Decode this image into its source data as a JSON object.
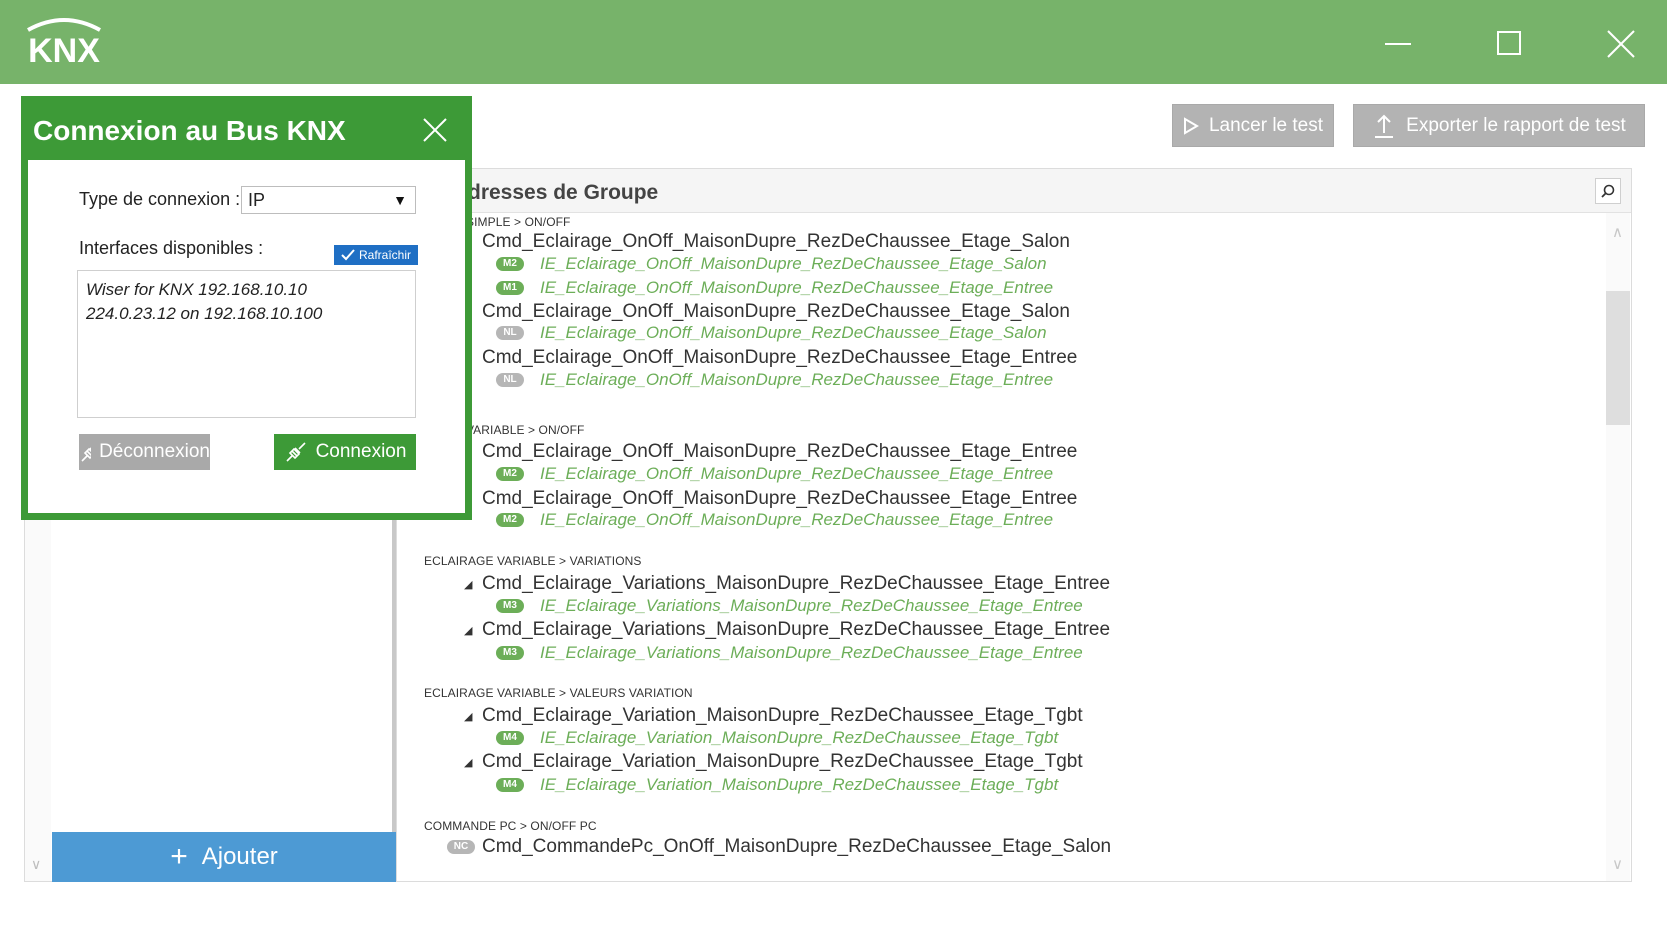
{
  "app": {
    "logo_text": "KNX"
  },
  "toolbar": {
    "run_test_label": "Lancer le test",
    "export_label": "Exporter le rapport de test"
  },
  "left_panel": {
    "add_label": "Ajouter"
  },
  "main": {
    "title": "dresses de Groupe",
    "groups": [
      {
        "category": "GE SIMPLE > ON/OFF",
        "items": [
          {
            "name": "Cmd_Eclairage_OnOff_MaisonDupre_RezDeChaussee_Etage_Salon",
            "objects": [
              {
                "badge": "M2",
                "name": "IE_Eclairage_OnOff_MaisonDupre_RezDeChaussee_Etage_Salon"
              },
              {
                "badge": "M1",
                "name": "IE_Eclairage_OnOff_MaisonDupre_RezDeChaussee_Etage_Entree"
              }
            ]
          },
          {
            "name": "Cmd_Eclairage_OnOff_MaisonDupre_RezDeChaussee_Etage_Salon",
            "objects": [
              {
                "badge": "NL",
                "name": "IE_Eclairage_OnOff_MaisonDupre_RezDeChaussee_Etage_Salon"
              }
            ]
          },
          {
            "name": "Cmd_Eclairage_OnOff_MaisonDupre_RezDeChaussee_Etage_Entree",
            "objects": [
              {
                "badge": "NL",
                "name": "IE_Eclairage_OnOff_MaisonDupre_RezDeChaussee_Etage_Entree"
              }
            ]
          }
        ]
      },
      {
        "category": "GE VARIABLE > ON/OFF",
        "items": [
          {
            "name": "Cmd_Eclairage_OnOff_MaisonDupre_RezDeChaussee_Etage_Entree",
            "objects": [
              {
                "badge": "M2",
                "name": "IE_Eclairage_OnOff_MaisonDupre_RezDeChaussee_Etage_Entree"
              }
            ]
          },
          {
            "name": "Cmd_Eclairage_OnOff_MaisonDupre_RezDeChaussee_Etage_Entree",
            "objects": [
              {
                "badge": "M2",
                "name": "IE_Eclairage_OnOff_MaisonDupre_RezDeChaussee_Etage_Entree"
              }
            ]
          }
        ]
      },
      {
        "category": "ECLAIRAGE VARIABLE > VARIATIONS",
        "items": [
          {
            "name": "Cmd_Eclairage_Variations_MaisonDupre_RezDeChaussee_Etage_Entree",
            "objects": [
              {
                "badge": "M3",
                "name": "IE_Eclairage_Variations_MaisonDupre_RezDeChaussee_Etage_Entree"
              }
            ]
          },
          {
            "name": "Cmd_Eclairage_Variations_MaisonDupre_RezDeChaussee_Etage_Entree",
            "objects": [
              {
                "badge": "M3",
                "name": "IE_Eclairage_Variations_MaisonDupre_RezDeChaussee_Etage_Entree"
              }
            ]
          }
        ]
      },
      {
        "category": "ECLAIRAGE VARIABLE > VALEURS VARIATION",
        "items": [
          {
            "name": "Cmd_Eclairage_Variation_MaisonDupre_RezDeChaussee_Etage_Tgbt",
            "objects": [
              {
                "badge": "M4",
                "name": "IE_Eclairage_Variation_MaisonDupre_RezDeChaussee_Etage_Tgbt"
              }
            ]
          },
          {
            "name": "Cmd_Eclairage_Variation_MaisonDupre_RezDeChaussee_Etage_Tgbt",
            "objects": [
              {
                "badge": "M4",
                "name": "IE_Eclairage_Variation_MaisonDupre_RezDeChaussee_Etage_Tgbt"
              }
            ]
          }
        ]
      },
      {
        "category": "COMMANDE PC > ON/OFF PC",
        "items": [
          {
            "badge": "NC",
            "name": "Cmd_CommandePc_OnOff_MaisonDupre_RezDeChaussee_Etage_Salon"
          }
        ]
      }
    ]
  },
  "dialog": {
    "title": "Connexion au Bus KNX",
    "connection_type_label": "Type de connexion :",
    "connection_type_value": "IP",
    "interfaces_label": "Interfaces disponibles :",
    "refresh_label": "Rafraîchir",
    "interfaces": [
      "Wiser for KNX 192.168.10.10",
      "224.0.23.12 on 192.168.10.100"
    ],
    "disconnect_label": "Déconnexion",
    "connect_label": "Connexion"
  },
  "colors": {
    "titlebar": "#77b36a",
    "dialog_green": "#3d9a37",
    "object_green": "#6cae58",
    "add_blue": "#4d9ad4",
    "refresh_blue": "#1f6fc4",
    "button_gray": "#b3b3b3"
  }
}
